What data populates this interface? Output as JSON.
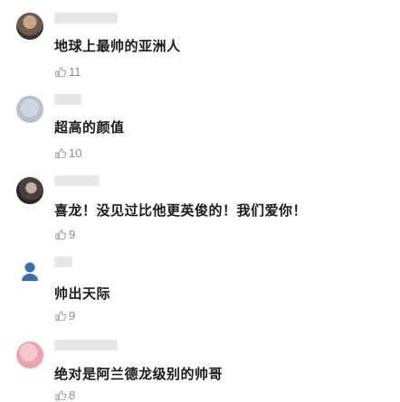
{
  "comments": [
    {
      "text": "地球上最帅的亚洲人",
      "likes": "11"
    },
    {
      "text": "超高的颜值",
      "likes": "10"
    },
    {
      "text": "喜龙！没见过比他更英俊的！我们爱你！",
      "likes": "9"
    },
    {
      "text": "帅出天际",
      "likes": "9"
    },
    {
      "text": "绝对是阿兰德龙级别的帅哥",
      "likes": "8"
    }
  ],
  "icons": {
    "like": "thumbs-up-icon"
  },
  "colors": {
    "text": "#1a1a1a",
    "meta": "#8a8a8a",
    "avatar_blue": "#3b6fb0"
  }
}
